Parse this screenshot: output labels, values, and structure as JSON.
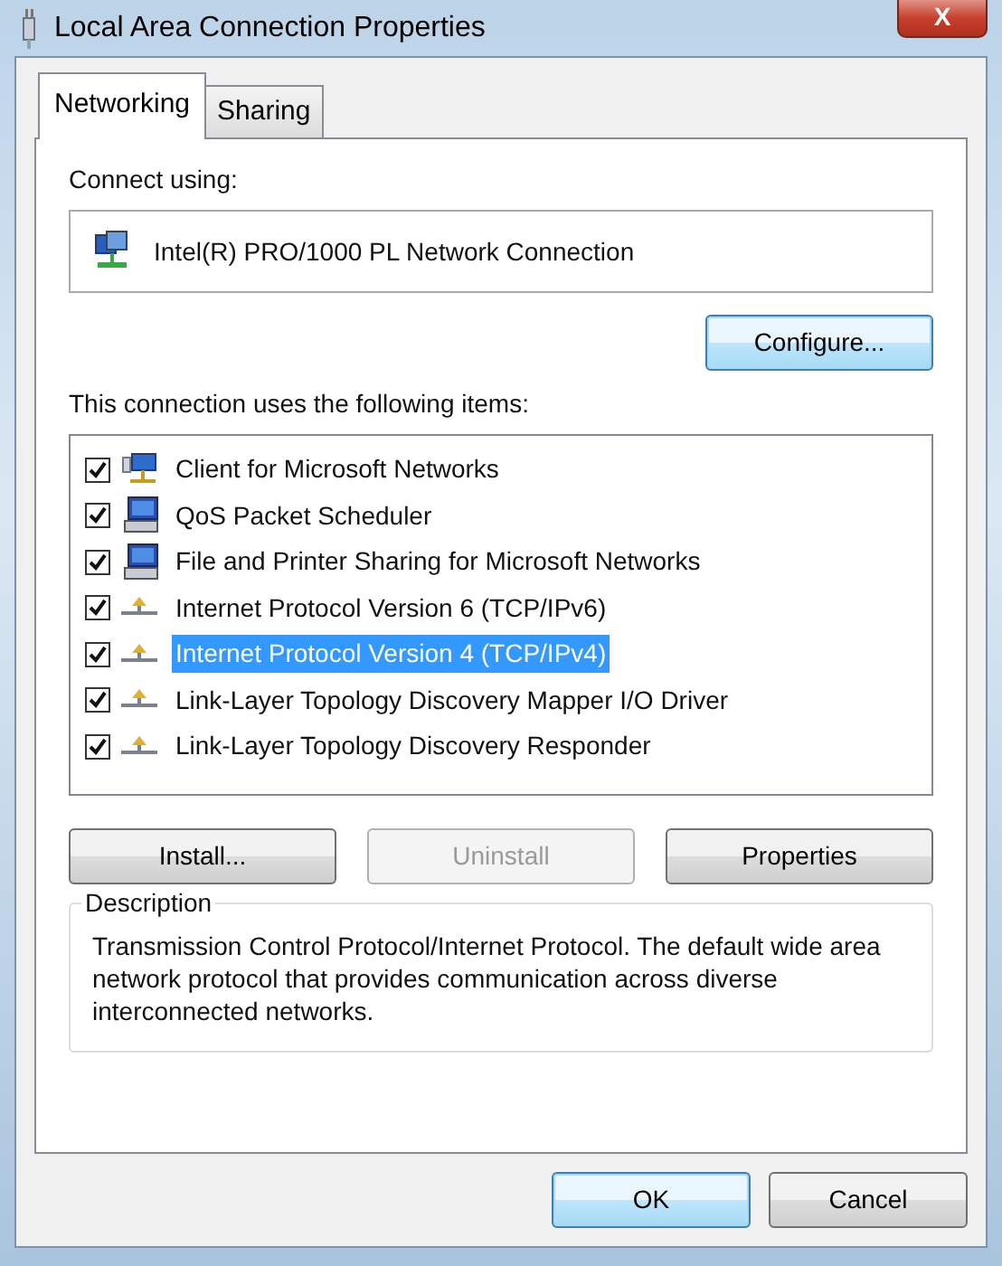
{
  "window": {
    "title": "Local Area Connection Properties",
    "close": "X"
  },
  "tabs": [
    {
      "label": "Networking",
      "selected": true
    },
    {
      "label": "Sharing",
      "selected": false
    }
  ],
  "connect_using": {
    "label": "Connect using:",
    "adapter": "Intel(R) PRO/1000 PL Network Connection",
    "configure_button": "Configure..."
  },
  "items_label": "This connection uses the following items:",
  "items": [
    {
      "label": "Client for Microsoft Networks",
      "kind": "client",
      "checked": true,
      "selected": false
    },
    {
      "label": "QoS Packet Scheduler",
      "kind": "computer",
      "checked": true,
      "selected": false
    },
    {
      "label": "File and Printer Sharing for Microsoft Networks",
      "kind": "computer",
      "checked": true,
      "selected": false
    },
    {
      "label": "Internet Protocol Version 6 (TCP/IPv6)",
      "kind": "protocol",
      "checked": true,
      "selected": false
    },
    {
      "label": "Internet Protocol Version 4 (TCP/IPv4)",
      "kind": "protocol",
      "checked": true,
      "selected": true
    },
    {
      "label": "Link-Layer Topology Discovery Mapper I/O Driver",
      "kind": "protocol",
      "checked": true,
      "selected": false
    },
    {
      "label": "Link-Layer Topology Discovery Responder",
      "kind": "protocol",
      "checked": true,
      "selected": false
    }
  ],
  "item_buttons": [
    {
      "label": "Install...",
      "disabled": false
    },
    {
      "label": "Uninstall",
      "disabled": true
    },
    {
      "label": "Properties",
      "disabled": false
    }
  ],
  "description": {
    "title": "Description",
    "text": "Transmission Control Protocol/Internet Protocol. The default wide area network protocol that provides communication across diverse interconnected networks."
  },
  "dialog_buttons": [
    {
      "label": "OK",
      "default": true
    },
    {
      "label": "Cancel",
      "default": false
    }
  ]
}
